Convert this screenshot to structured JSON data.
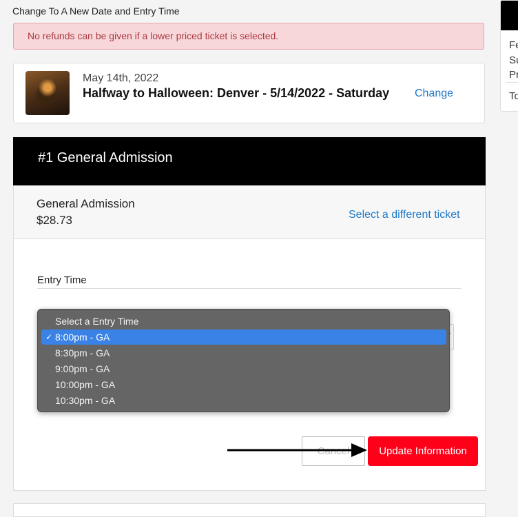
{
  "page": {
    "subtitle": "Change To A New Date and Entry Time"
  },
  "alert": {
    "message": "No refunds can be given if a lower priced ticket is selected."
  },
  "event": {
    "date": "May 14th, 2022",
    "title": "Halfway to Halloween: Denver - 5/14/2022 - Saturday",
    "change_label": "Change"
  },
  "ticket": {
    "header": "#1 General Admission",
    "name": "General Admission",
    "price": "$28.73",
    "select_different_label": "Select a different ticket"
  },
  "entry_time": {
    "label": "Entry Time",
    "options": [
      "Select a Entry Time",
      "8:00pm - GA",
      "8:30pm - GA",
      "9:00pm - GA",
      "10:00pm - GA",
      "10:30pm - GA"
    ],
    "selected": "8:00pm - GA",
    "check_glyph": "✓"
  },
  "actions": {
    "cancel_label": "Cancel",
    "update_label": "Update Information"
  },
  "side_panel": {
    "lines": [
      "Fe",
      "Su",
      "Pr",
      "To"
    ]
  },
  "colors": {
    "accent_link": "#1d78c7",
    "update_button": "#ff0019",
    "alert_bg": "#f8d7da",
    "selection": "#3a82e6"
  }
}
